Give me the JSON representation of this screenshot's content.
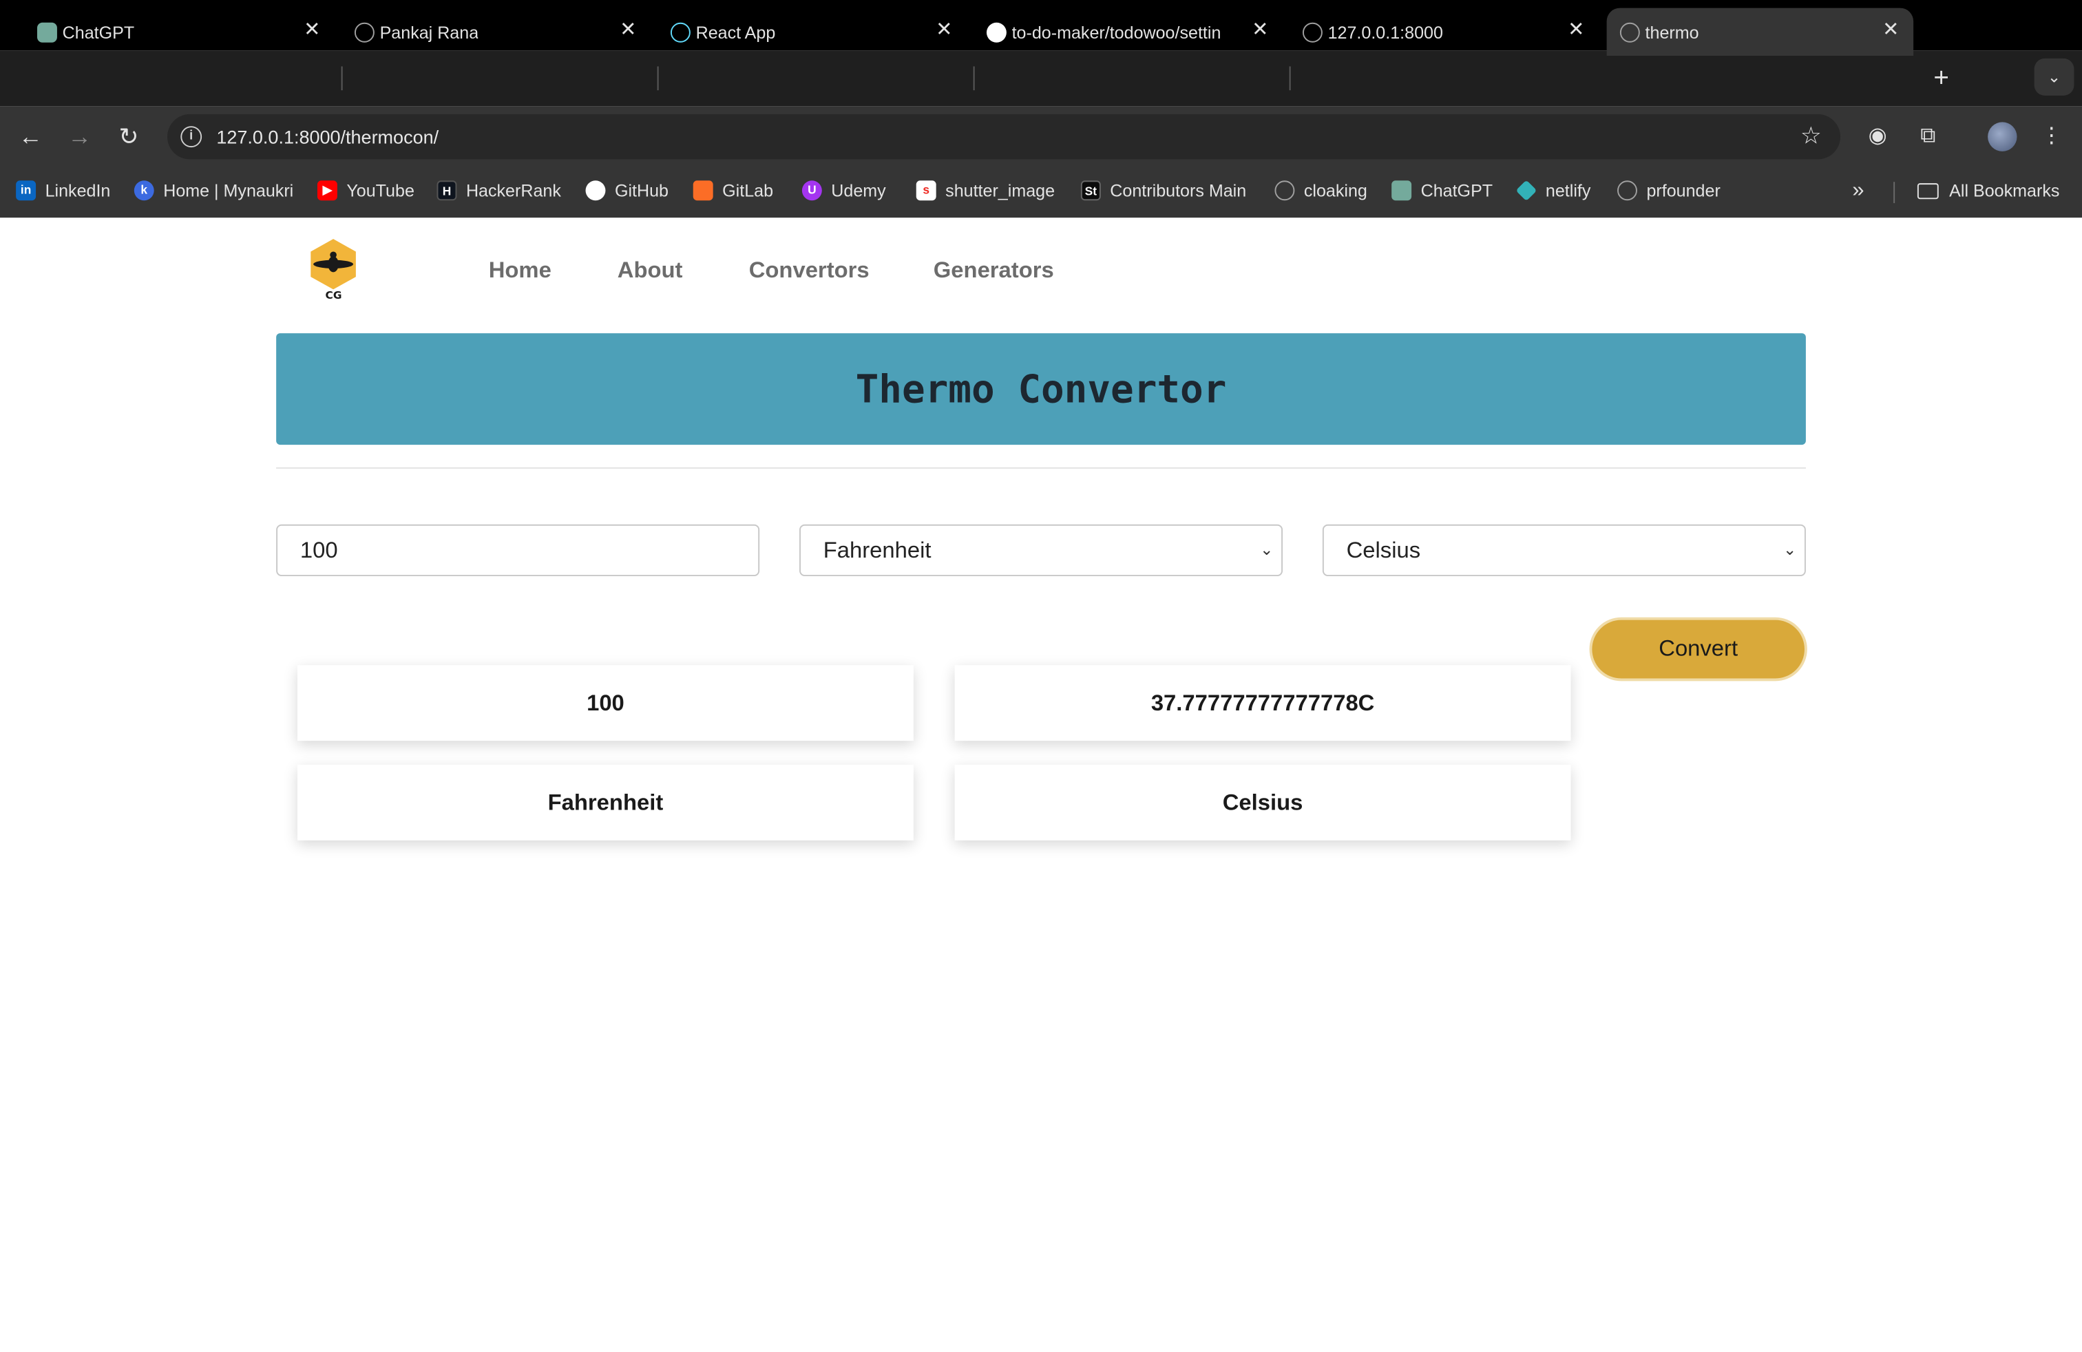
{
  "browser": {
    "tabs": [
      {
        "title": "ChatGPT",
        "icon": "chatgpt-icon",
        "color": "#74aa9c"
      },
      {
        "title": "Pankaj Rana",
        "icon": "globe-icon",
        "color": "#a0a0a0"
      },
      {
        "title": "React App",
        "icon": "react-icon",
        "color": "#61dafb"
      },
      {
        "title": "to-do-maker/todowoo/settin",
        "icon": "github-icon",
        "color": "#ffffff"
      },
      {
        "title": "127.0.0.1:8000",
        "icon": "globe-icon",
        "color": "#a0a0a0"
      },
      {
        "title": "thermo",
        "icon": "globe-icon",
        "color": "#a0a0a0"
      }
    ],
    "active_tab": 5,
    "url": "127.0.0.1:8000/thermocon/",
    "bookmarks": [
      {
        "label": "LinkedIn",
        "icon": "linkedin-icon",
        "color": "#0a66c2"
      },
      {
        "label": "Home | Mynaukri",
        "icon": "mynaukri-icon",
        "color": "#3c6ae0"
      },
      {
        "label": "YouTube",
        "icon": "youtube-icon",
        "color": "#ff0000"
      },
      {
        "label": "HackerRank",
        "icon": "hackerrank-icon",
        "color": "#0e141e"
      },
      {
        "label": "GitHub",
        "icon": "github-icon",
        "color": "#ffffff"
      },
      {
        "label": "GitLab",
        "icon": "gitlab-icon",
        "color": "#fc6d26"
      },
      {
        "label": "Udemy",
        "icon": "udemy-icon",
        "color": "#a435f0"
      },
      {
        "label": "shutter_image",
        "icon": "shutterstock-icon",
        "color": "#ee2b24"
      },
      {
        "label": "Contributors Main",
        "icon": "shutterstock-contrib-icon",
        "color": "#0c0c0c"
      },
      {
        "label": "cloaking",
        "icon": "globe-icon",
        "color": "#a0a0a0"
      },
      {
        "label": "ChatGPT",
        "icon": "chatgpt-icon",
        "color": "#74aa9c"
      },
      {
        "label": "netlify",
        "icon": "netlify-icon",
        "color": "#32b2b8"
      },
      {
        "label": "prfounder",
        "icon": "globe-icon",
        "color": "#a0a0a0"
      }
    ],
    "all_bookmarks": "All Bookmarks"
  },
  "site": {
    "logo_text": "CG",
    "nav": [
      "Home",
      "About",
      "Convertors",
      "Generators"
    ]
  },
  "converter": {
    "title": "Thermo Convertor",
    "input_value": "100",
    "from_unit": "Fahrenheit",
    "to_unit": "Celsius",
    "convert_label": "Convert"
  },
  "result": {
    "input_value": "100",
    "output_value": "37.77777777777778C",
    "input_unit": "Fahrenheit",
    "output_unit": "Celsius"
  },
  "colors": {
    "banner": "#4da0b8",
    "convert_button": "#d9a93a",
    "logo": "#f2b53a"
  }
}
